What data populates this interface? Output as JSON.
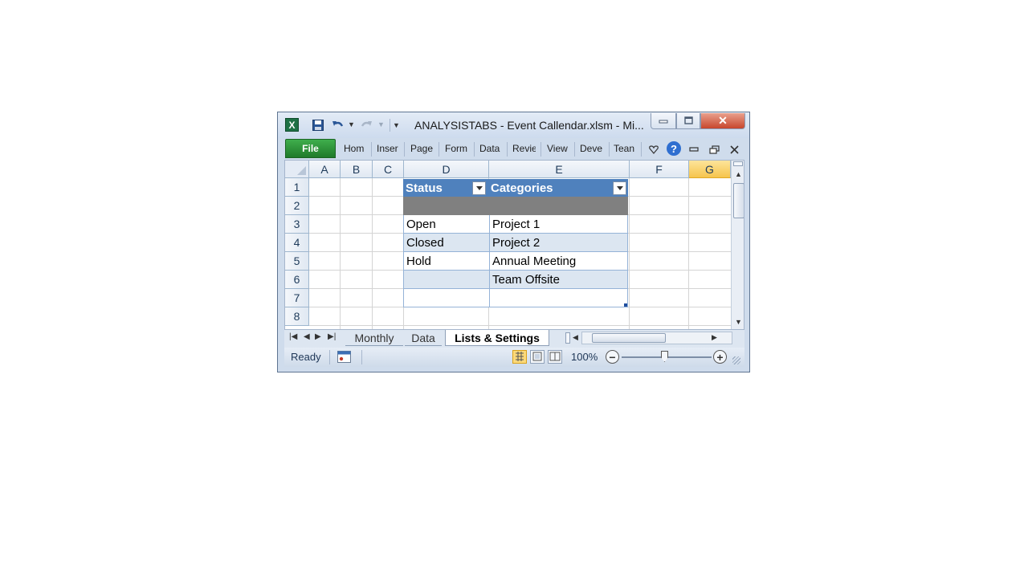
{
  "window": {
    "title": "ANALYSISTABS - Event Callendar.xlsm  -  Mi...",
    "close_glyph": "✕",
    "app_icon_letter": "X"
  },
  "ribbon": {
    "file_label": "File",
    "tabs": [
      "Hom",
      "Inser",
      "Page",
      "Form",
      "Data",
      "Revie",
      "View",
      "Deve",
      "Tean"
    ],
    "help_glyph": "?"
  },
  "grid": {
    "columns": [
      "A",
      "B",
      "C",
      "D",
      "E",
      "F",
      "G"
    ],
    "selected_column": "G",
    "rows": [
      "1",
      "2",
      "3",
      "4",
      "5",
      "6",
      "7",
      "8"
    ]
  },
  "table": {
    "headers": [
      "Status",
      "Categories"
    ],
    "header_color": "#4f81bd",
    "band_color": "#dce6f1",
    "gray_row_color": "#808080",
    "rows": [
      {
        "status": "Open",
        "category": "Project 1"
      },
      {
        "status": "Closed",
        "category": "Project 2"
      },
      {
        "status": "Hold",
        "category": "Annual Meeting"
      },
      {
        "status": "",
        "category": "Team Offsite"
      }
    ]
  },
  "sheet_tabs": {
    "tabs": [
      "Monthly",
      "Data",
      "Lists & Settings"
    ],
    "active": "Lists & Settings"
  },
  "status_bar": {
    "status": "Ready",
    "zoom": "100%"
  }
}
